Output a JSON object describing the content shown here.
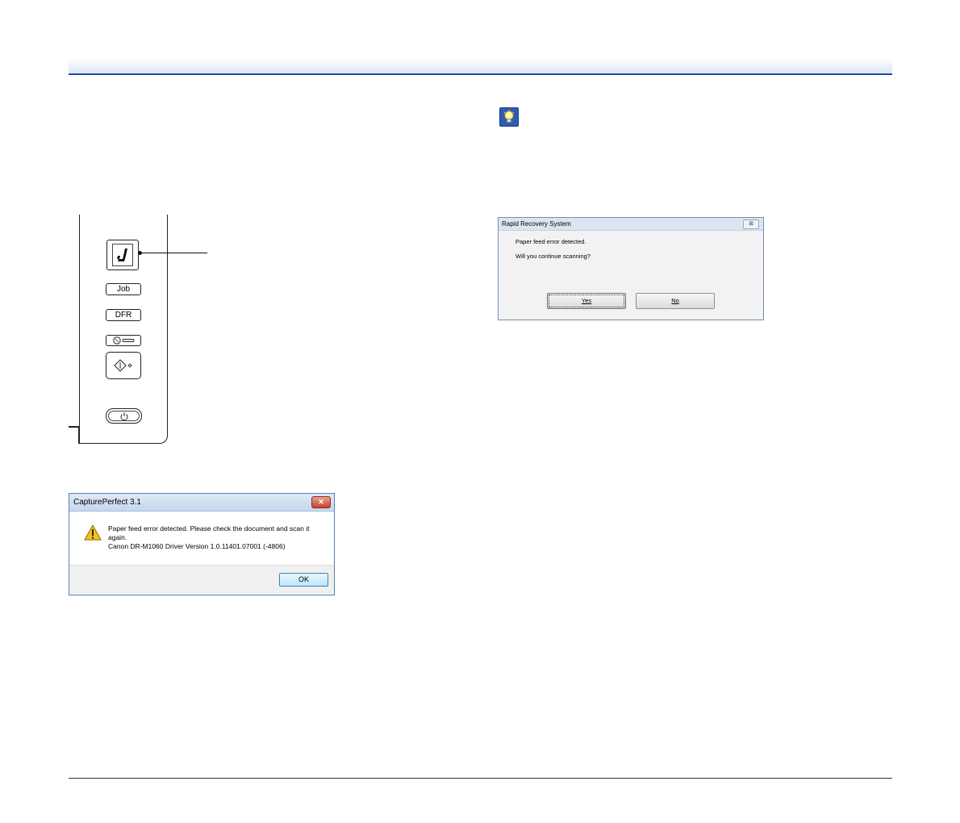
{
  "panel": {
    "job_label": "Job",
    "dfr_label": "DFR"
  },
  "dialog_captureperfect": {
    "title": "CapturePerfect 3.1",
    "close_glyph": "✕",
    "message_line1": "Paper feed error detected.  Please check the document and scan it",
    "message_line2": "again.",
    "message_line3": "Canon DR-M1060 Driver Version 1.0.11401.07001 (-4806)",
    "ok_label": "OK"
  },
  "dialog_rapid_recovery": {
    "title": "Rapid Recovery System",
    "close_glyph": "⊠",
    "message_line1": "Paper feed error detected.",
    "message_line2": "Will you continue scanning?",
    "yes_label": "Yes",
    "no_label": "No"
  },
  "icons": {
    "hint": "lightbulb-icon",
    "warning": "warning-icon",
    "start": "start-icon",
    "stop": "stop-icon",
    "power": "power-icon"
  },
  "colors": {
    "header_rule": "#1f4e9c",
    "hint_icon_bg": "#2f5bb3",
    "warning_yellow": "#f4c21a"
  }
}
